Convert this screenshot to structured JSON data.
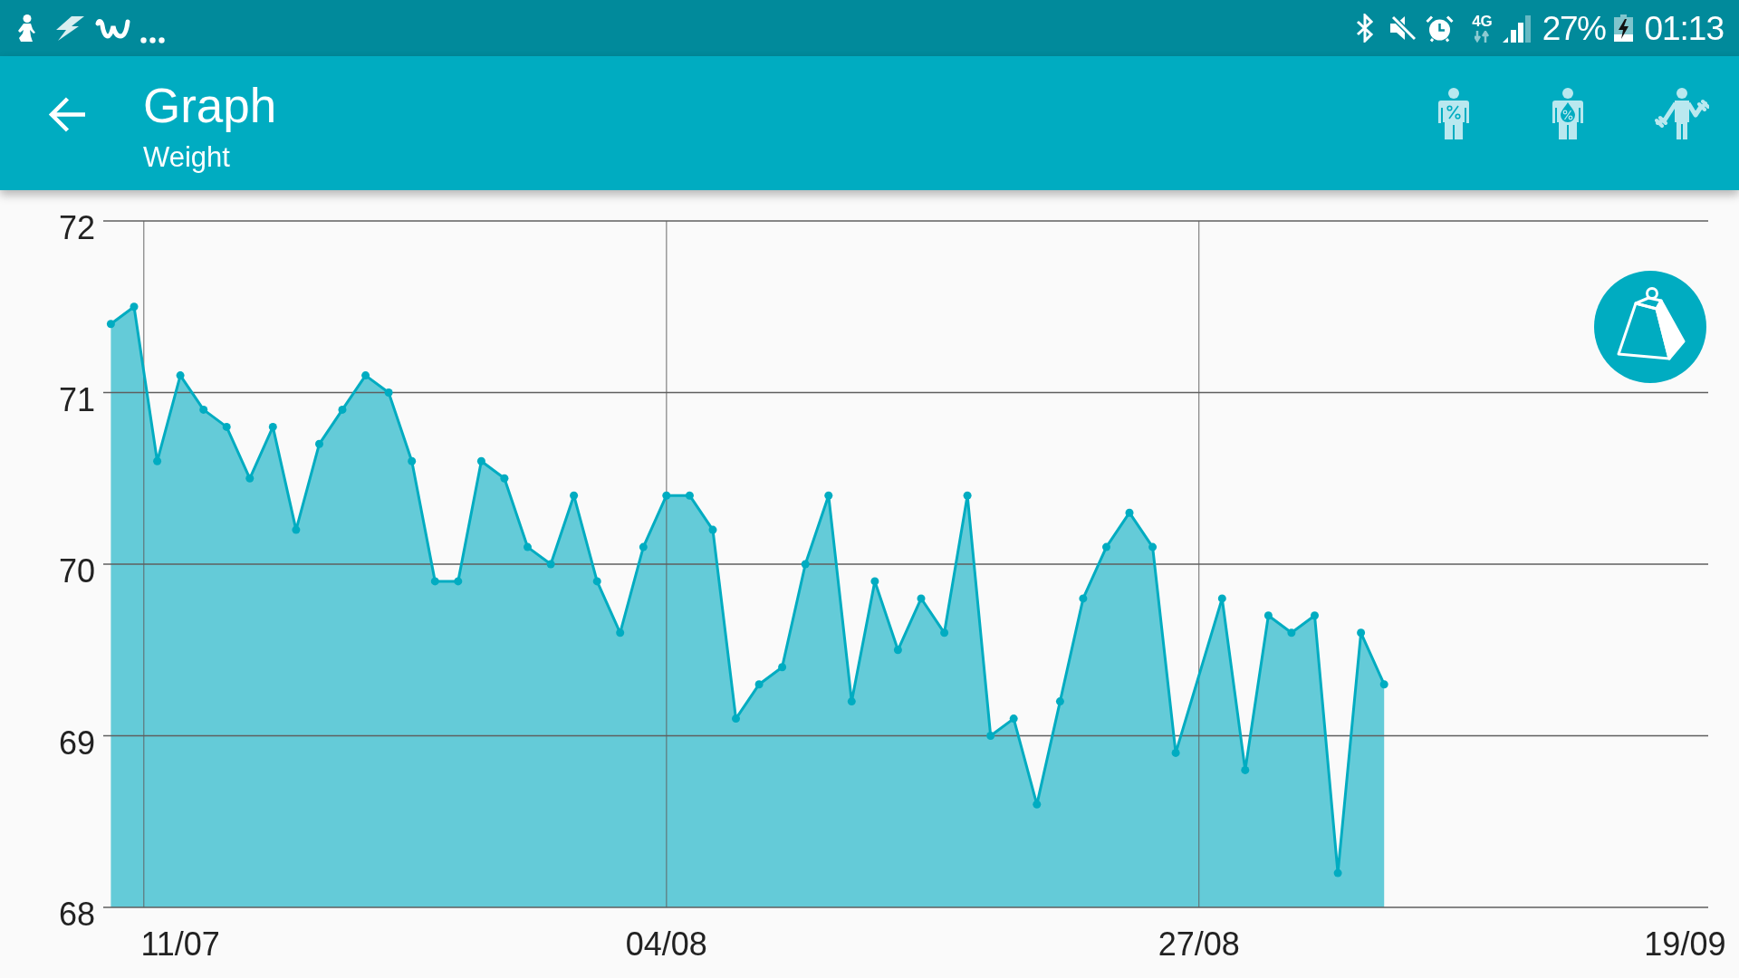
{
  "status_bar": {
    "network": "4G",
    "battery": "27%",
    "time": "01:13"
  },
  "toolbar": {
    "title": "Graph",
    "subtitle": "Weight"
  },
  "chart": {
    "chart_data": {
      "type": "area",
      "grid": true,
      "ylim": [
        68,
        72
      ],
      "yticks": [
        68,
        69,
        70,
        71,
        72
      ],
      "categories": [
        null,
        null,
        null,
        "11/07",
        null,
        null,
        null,
        null,
        null,
        null,
        null,
        null,
        null,
        null,
        null,
        null,
        null,
        null,
        null,
        null,
        null,
        null,
        null,
        null,
        "04/08",
        null,
        null,
        null,
        null,
        null,
        null,
        null,
        null,
        null,
        null,
        null,
        null,
        null,
        null,
        null,
        null,
        null,
        null,
        null,
        null,
        null,
        null,
        "27/08",
        null,
        null,
        null,
        null,
        null,
        null,
        null,
        null,
        null,
        null,
        null,
        null,
        null,
        null,
        null,
        null,
        null,
        null,
        null,
        null,
        "19/09"
      ],
      "series": [
        {
          "color": "#00acc1",
          "values": [
            71.4,
            71.5,
            70.6,
            71.1,
            70.9,
            70.8,
            70.5,
            70.8,
            70.2,
            70.7,
            70.9,
            71.1,
            71.0,
            70.6,
            69.9,
            69.9,
            70.6,
            70.5,
            70.1,
            70.0,
            70.4,
            69.9,
            69.6,
            70.1,
            70.4,
            70.4,
            70.2,
            69.1,
            69.3,
            69.4,
            70.0,
            70.4,
            69.2,
            69.9,
            69.5,
            69.8,
            69.6,
            70.4,
            69.0,
            69.1,
            68.6,
            69.2,
            69.8,
            70.1,
            70.3,
            70.1,
            68.9,
            null,
            69.8,
            68.8,
            69.7,
            69.6,
            69.7,
            68.2,
            69.6,
            69.3,
            null,
            null,
            null,
            null,
            null,
            null,
            null,
            null,
            null,
            null,
            null,
            null,
            null
          ]
        }
      ]
    }
  }
}
